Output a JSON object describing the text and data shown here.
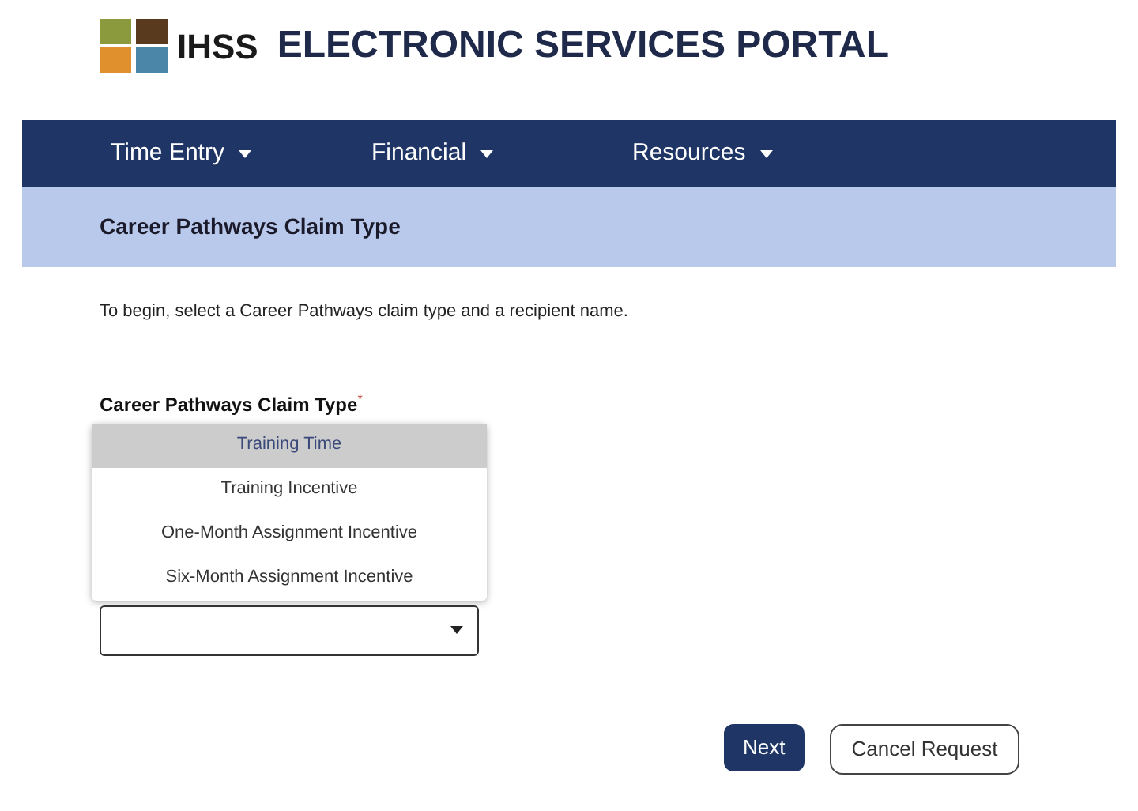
{
  "header": {
    "brand": "IHSS",
    "title": "ELECTRONIC SERVICES PORTAL"
  },
  "nav": [
    {
      "label": "Time Entry"
    },
    {
      "label": "Financial"
    },
    {
      "label": "Resources"
    }
  ],
  "page_title": "Career Pathways Claim Type",
  "intro": "To begin, select a Career Pathways claim type and a recipient name.",
  "field": {
    "label": "Career Pathways Claim Type",
    "required_mark": "*",
    "options": [
      {
        "label": "Training Time",
        "selected": true
      },
      {
        "label": "Training Incentive",
        "selected": false
      },
      {
        "label": "One-Month Assignment Incentive",
        "selected": false
      },
      {
        "label": "Six-Month Assignment Incentive",
        "selected": false
      }
    ]
  },
  "buttons": [
    {
      "label": "Next",
      "kind": "primary"
    },
    {
      "label": "Cancel Request",
      "kind": "secondary"
    }
  ]
}
